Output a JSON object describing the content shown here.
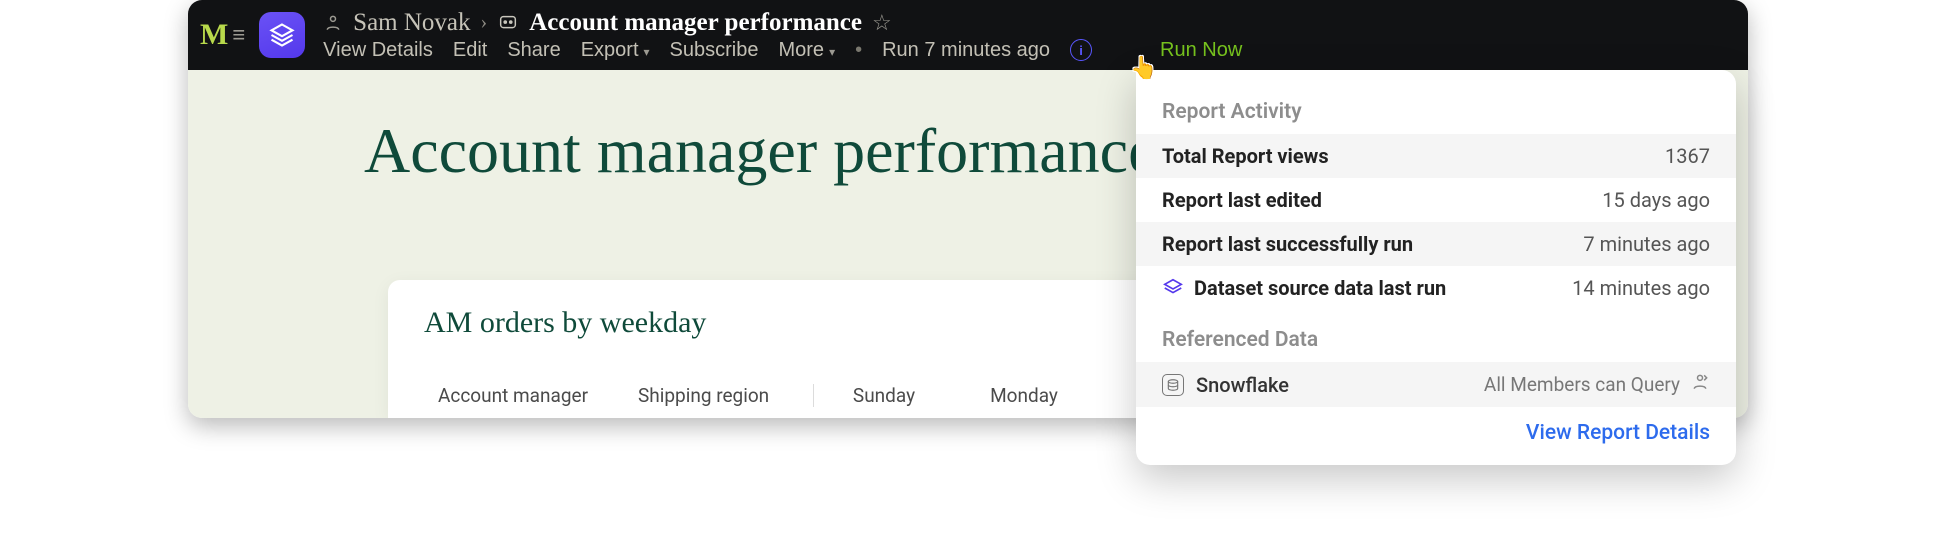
{
  "breadcrumb": {
    "user": "Sam Novak",
    "title": "Account manager performance"
  },
  "toolbar": {
    "view_details": "View Details",
    "edit": "Edit",
    "share": "Share",
    "export": "Export",
    "subscribe": "Subscribe",
    "more": "More",
    "run_status": "Run 7 minutes ago",
    "run_now": "Run Now"
  },
  "page": {
    "title": "Account manager performance"
  },
  "card": {
    "title": "AM orders by weekday",
    "columns": {
      "am": "Account manager",
      "region": "Shipping region",
      "sunday": "Sunday",
      "monday": "Monday"
    }
  },
  "popover": {
    "report_activity": "Report Activity",
    "rows": {
      "total_views_label": "Total Report views",
      "total_views_value": "1367",
      "last_edited_label": "Report last edited",
      "last_edited_value": "15 days ago",
      "last_run_label": "Report last successfully run",
      "last_run_value": "7 minutes ago",
      "dataset_label": "Dataset source data last run",
      "dataset_value": "14 minutes ago"
    },
    "referenced_data": "Referenced Data",
    "ref_source": "Snowflake",
    "ref_perm": "All Members can Query",
    "footer_link": "View Report Details"
  }
}
